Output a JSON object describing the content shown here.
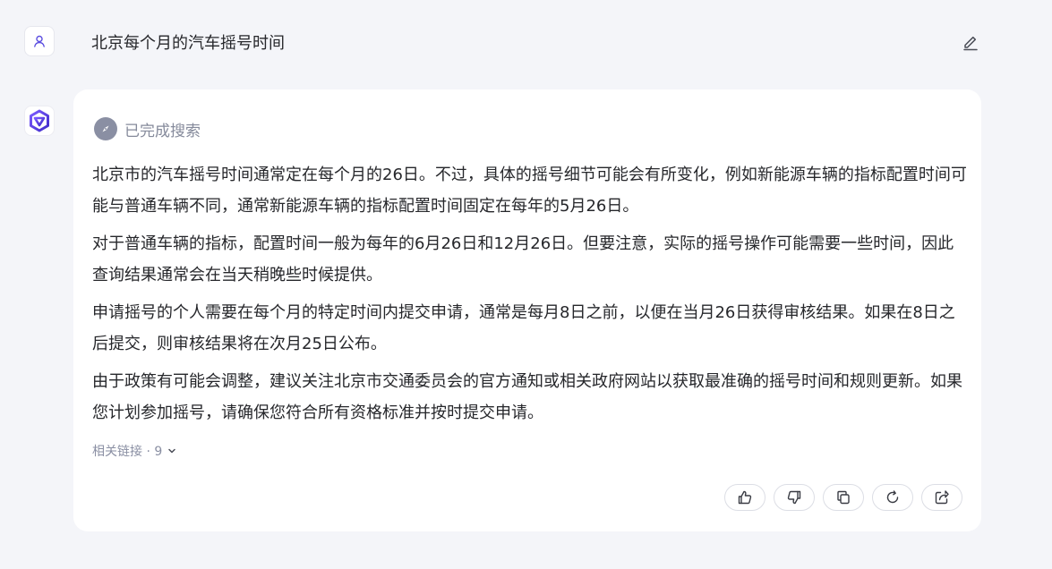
{
  "conversation": {
    "question": "北京每个月的汽车摇号时间",
    "search_status": "已完成搜索",
    "answer_paragraphs": [
      "北京市的汽车摇号时间通常定在每个月的26日。不过，具体的摇号细节可能会有所变化，例如新能源车辆的指标配置时间可能与普通车辆不同，通常新能源车辆的指标配置时间固定在每年的5月26日。",
      "对于普通车辆的指标，配置时间一般为每年的6月26日和12月26日。但要注意，实际的摇号操作可能需要一些时间，因此查询结果通常会在当天稍晚些时候提供。",
      "申请摇号的个人需要在每个月的特定时间内提交申请，通常是每月8日之前，以便在当月26日获得审核结果。如果在8日之后提交，则审核结果将在次月25日公布。",
      "由于政策有可能会调整，建议关注北京市交通委员会的官方通知或相关政府网站以获取最准确的摇号时间和规则更新。如果您计划参加摇号，请确保您符合所有资格标准并按时提交申请。"
    ],
    "related_links": "相关链接 · 9"
  },
  "icons": {
    "user_avatar": "user-icon",
    "bot_avatar": "assistant-logo-icon",
    "edit": "pencil-icon",
    "search_status": "compass-icon",
    "expand": "chevron-down-icon",
    "actions": [
      "thumbs-up-icon",
      "thumbs-down-icon",
      "copy-icon",
      "regenerate-icon",
      "share-icon"
    ]
  },
  "colors": {
    "background": "#f4f5f9",
    "card": "#ffffff",
    "text": "#26272b",
    "muted": "#858a9b",
    "brand": "#5b4ee0"
  }
}
